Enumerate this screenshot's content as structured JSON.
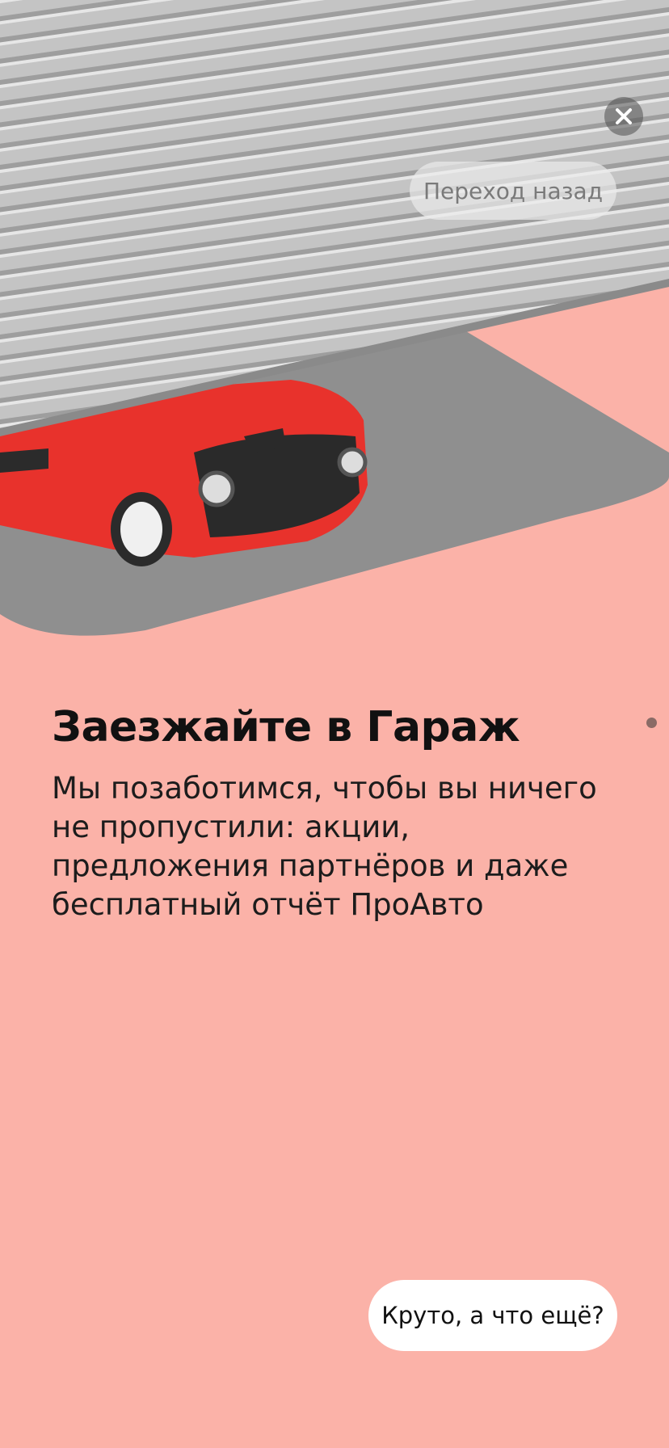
{
  "story": {
    "back_label": "Переход назад",
    "title": "Заезжайте в Гараж",
    "description": "Мы позаботимся, чтобы вы ничего не пропустили: акции, предложения партнёров и даже бесплатный отчёт ПроАвто",
    "cta_label": "Круто, а что ещё?"
  },
  "icons": {
    "close": "close-icon",
    "indicator": "page-dot"
  },
  "colors": {
    "background": "#FBB2A8",
    "car": "#E8322C",
    "shutter": "#BDBDBD",
    "floor": "#8E8E8E"
  }
}
